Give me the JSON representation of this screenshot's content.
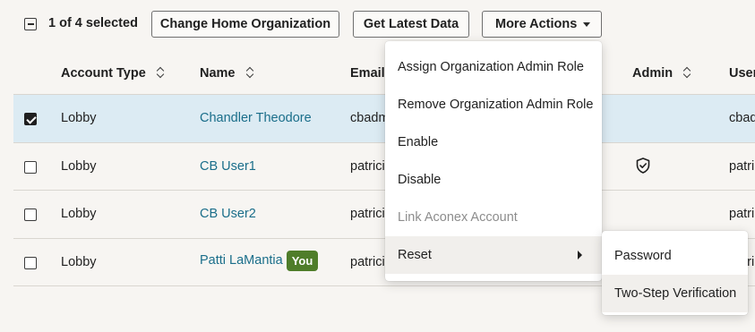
{
  "toolbar": {
    "selection_text": "1 of 4 selected",
    "change_home_label": "Change Home Organization",
    "get_latest_label": "Get Latest Data",
    "more_actions_label": "More Actions"
  },
  "table": {
    "headers": {
      "account_type": "Account Type",
      "name": "Name",
      "email": "Email",
      "admin": "Admin",
      "user": "User"
    },
    "rows": [
      {
        "checked": true,
        "account_type": "Lobby",
        "name": "Chandler Theodore",
        "email": "cbadmin",
        "admin_icon": "",
        "user": "cbadm",
        "you": false
      },
      {
        "checked": false,
        "account_type": "Lobby",
        "name": "CB User1",
        "email": "patricia",
        "admin_icon": "shield-check-icon",
        "user": "patri",
        "you": false
      },
      {
        "checked": false,
        "account_type": "Lobby",
        "name": "CB User2",
        "email": "patricia",
        "admin_icon": "",
        "user": "patri",
        "you": false
      },
      {
        "checked": false,
        "account_type": "Lobby",
        "name": "Patti LaMantia",
        "email": "patricia",
        "admin_icon": "",
        "user": "patri",
        "you": true
      }
    ],
    "you_badge": "You"
  },
  "menu": {
    "items": [
      {
        "label": "Assign Organization Admin Role",
        "disabled": false
      },
      {
        "label": "Remove Organization Admin Role",
        "disabled": false
      },
      {
        "label": "Enable",
        "disabled": false
      },
      {
        "label": "Disable",
        "disabled": false
      },
      {
        "label": "Link Aconex Account",
        "disabled": true
      },
      {
        "label": "Reset",
        "disabled": false,
        "has_submenu": true
      }
    ]
  },
  "submenu": {
    "items": [
      {
        "label": "Password"
      },
      {
        "label": "Two-Step Verification"
      }
    ]
  },
  "colors": {
    "selected_row": "#dcebf3",
    "link": "#1a6e8a",
    "you_badge": "#4f7d2a"
  }
}
